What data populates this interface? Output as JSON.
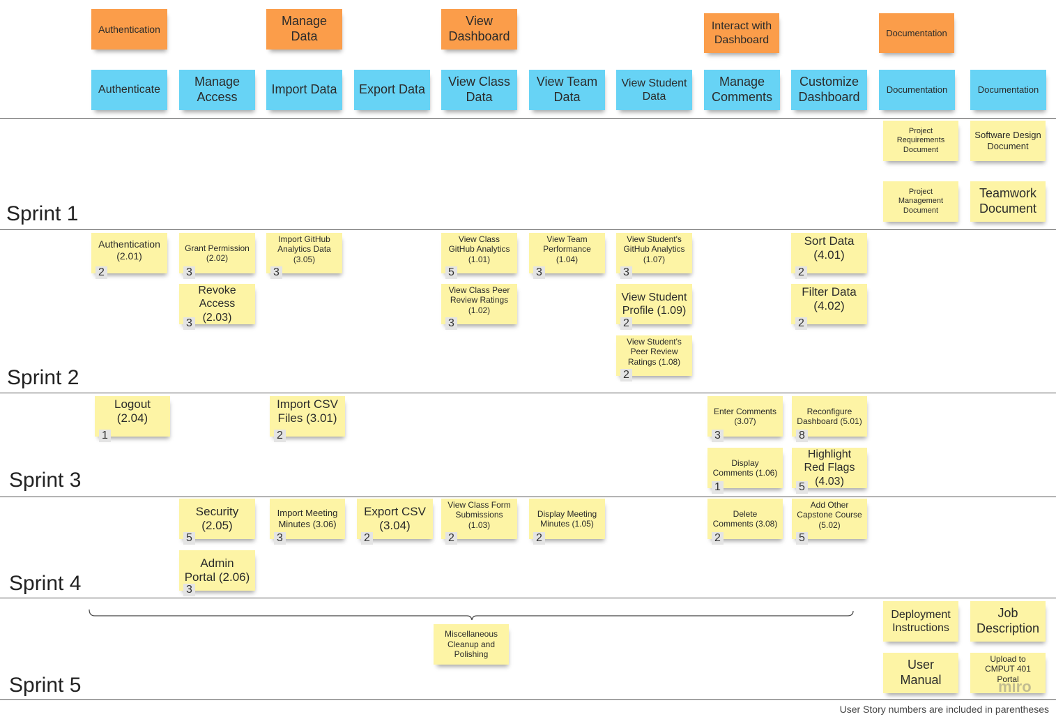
{
  "epics": [
    {
      "label": "Authentication"
    },
    {
      "label": "Manage Data"
    },
    {
      "label": "View Dashboard"
    },
    {
      "label": "Interact with Dashboard"
    },
    {
      "label": "Documentation"
    }
  ],
  "features": [
    {
      "label": "Authenticate"
    },
    {
      "label": "Manage Access"
    },
    {
      "label": "Import Data"
    },
    {
      "label": "Export Data"
    },
    {
      "label": "View Class Data"
    },
    {
      "label": "View Team Data"
    },
    {
      "label": "View Student Data"
    },
    {
      "label": "Manage Comments"
    },
    {
      "label": "Customize Dashboard"
    },
    {
      "label": "Documentation"
    },
    {
      "label": "Documentation"
    }
  ],
  "sprints": [
    {
      "label": "Sprint 1"
    },
    {
      "label": "Sprint 2"
    },
    {
      "label": "Sprint 3"
    },
    {
      "label": "Sprint 4"
    },
    {
      "label": "Sprint 5"
    }
  ],
  "stories": {
    "sprint1": [
      {
        "label": "Project Requirements Document"
      },
      {
        "label": "Software Design Document"
      },
      {
        "label": "Project Management Document"
      },
      {
        "label": "Teamwork Document"
      }
    ],
    "sprint2": [
      {
        "label": "Authentication (2.01)",
        "points": "2"
      },
      {
        "label": "Grant Permission (2.02)",
        "points": "3"
      },
      {
        "label": "Revoke Access (2.03)",
        "points": "3"
      },
      {
        "label": "Import GitHub Analytics Data (3.05)",
        "points": "3"
      },
      {
        "label": "View Class GitHub Analytics (1.01)",
        "points": "5"
      },
      {
        "label": "View Class Peer Review Ratings (1.02)",
        "points": "3"
      },
      {
        "label": "View Team Performance (1.04)",
        "points": "3"
      },
      {
        "label": "View Student's GitHub Analytics (1.07)",
        "points": "3"
      },
      {
        "label": "View Student Profile (1.09)",
        "points": "2"
      },
      {
        "label": "View Student's Peer Review Ratings (1.08)",
        "points": "2"
      },
      {
        "label": "Sort Data (4.01)",
        "points": "2"
      },
      {
        "label": "Filter Data (4.02)",
        "points": "2"
      }
    ],
    "sprint3": [
      {
        "label": "Logout (2.04)",
        "points": "1"
      },
      {
        "label": "Import CSV Files (3.01)",
        "points": "2"
      },
      {
        "label": "Enter Comments (3.07)",
        "points": "3"
      },
      {
        "label": "Reconfigure Dashboard (5.01)",
        "points": "8"
      },
      {
        "label": "Display Comments (1.06)",
        "points": "1"
      },
      {
        "label": "Highlight Red Flags (4.03)",
        "points": "5"
      }
    ],
    "sprint4": [
      {
        "label": "Security (2.05)",
        "points": "5"
      },
      {
        "label": "Admin Portal (2.06)",
        "points": "3"
      },
      {
        "label": "Import Meeting Minutes (3.06)",
        "points": "3"
      },
      {
        "label": "Export CSV (3.04)",
        "points": "2"
      },
      {
        "label": "View Class Form Submissions (1.03)",
        "points": "2"
      },
      {
        "label": "Display Meeting Minutes (1.05)",
        "points": "2"
      },
      {
        "label": "Delete Comments (3.08)",
        "points": "2"
      },
      {
        "label": "Add Other Capstone Course (5.02)",
        "points": "5"
      }
    ],
    "sprint5": [
      {
        "label": "Miscellaneous Cleanup and Polishing"
      },
      {
        "label": "Deployment Instructions"
      },
      {
        "label": "Job Description"
      },
      {
        "label": "User Manual"
      },
      {
        "label": "Upload to CMPUT 401 Portal"
      }
    ]
  },
  "footer_note": "User Story numbers are included in parentheses",
  "watermark": "miro",
  "colors": {
    "epic": "#fb9d4a",
    "feature": "#67d3f5",
    "story": "#fdf4a5"
  }
}
